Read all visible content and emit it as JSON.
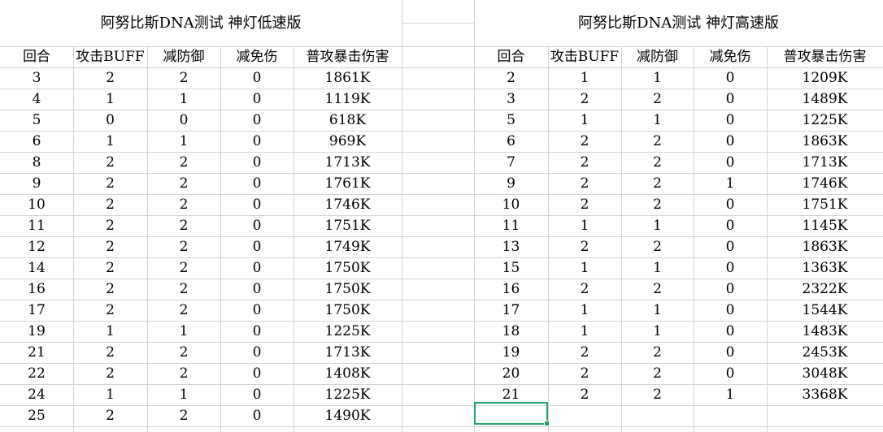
{
  "left_table": {
    "title": "阿努比斯DNA测试 神灯低速版",
    "headers": [
      "回合",
      "攻击BUFF",
      "减防御",
      "减免伤",
      "普攻暴击伤害"
    ],
    "rows": [
      [
        "3",
        "2",
        "2",
        "0",
        "1861K"
      ],
      [
        "4",
        "1",
        "1",
        "0",
        "1119K"
      ],
      [
        "5",
        "0",
        "0",
        "0",
        "618K"
      ],
      [
        "6",
        "1",
        "1",
        "0",
        "969K"
      ],
      [
        "8",
        "2",
        "2",
        "0",
        "1713K"
      ],
      [
        "9",
        "2",
        "2",
        "0",
        "1761K"
      ],
      [
        "10",
        "2",
        "2",
        "0",
        "1746K"
      ],
      [
        "11",
        "2",
        "2",
        "0",
        "1751K"
      ],
      [
        "12",
        "2",
        "2",
        "0",
        "1749K"
      ],
      [
        "14",
        "2",
        "2",
        "0",
        "1750K"
      ],
      [
        "16",
        "2",
        "2",
        "0",
        "1750K"
      ],
      [
        "17",
        "2",
        "2",
        "0",
        "1750K"
      ],
      [
        "19",
        "1",
        "1",
        "0",
        "1225K"
      ],
      [
        "21",
        "2",
        "2",
        "0",
        "1713K"
      ],
      [
        "22",
        "2",
        "2",
        "0",
        "1408K"
      ],
      [
        "24",
        "1",
        "1",
        "0",
        "1225K"
      ],
      [
        "25",
        "2",
        "2",
        "0",
        "1490K"
      ]
    ]
  },
  "right_table": {
    "title": "阿努比斯DNA测试 神灯高速版",
    "headers": [
      "回合",
      "攻击BUFF",
      "减防御",
      "减免伤",
      "普攻暴击伤害"
    ],
    "rows": [
      [
        "2",
        "1",
        "1",
        "0",
        "1209K"
      ],
      [
        "3",
        "2",
        "2",
        "0",
        "1489K"
      ],
      [
        "5",
        "1",
        "1",
        "0",
        "1225K"
      ],
      [
        "6",
        "2",
        "2",
        "0",
        "1863K"
      ],
      [
        "7",
        "2",
        "2",
        "0",
        "1713K"
      ],
      [
        "9",
        "2",
        "2",
        "1",
        "1746K"
      ],
      [
        "10",
        "2",
        "2",
        "0",
        "1751K"
      ],
      [
        "11",
        "1",
        "1",
        "0",
        "1145K"
      ],
      [
        "13",
        "2",
        "2",
        "0",
        "1863K"
      ],
      [
        "15",
        "1",
        "1",
        "0",
        "1363K"
      ],
      [
        "16",
        "2",
        "2",
        "0",
        "2322K"
      ],
      [
        "17",
        "1",
        "1",
        "0",
        "1544K"
      ],
      [
        "18",
        "1",
        "1",
        "0",
        "1483K"
      ],
      [
        "19",
        "2",
        "2",
        "0",
        "2453K"
      ],
      [
        "20",
        "2",
        "2",
        "0",
        "3048K"
      ],
      [
        "21",
        "2",
        "2",
        "1",
        "3368K"
      ]
    ]
  },
  "colors": {
    "gridline": "#d4d4d4",
    "selection": "#21a366"
  }
}
